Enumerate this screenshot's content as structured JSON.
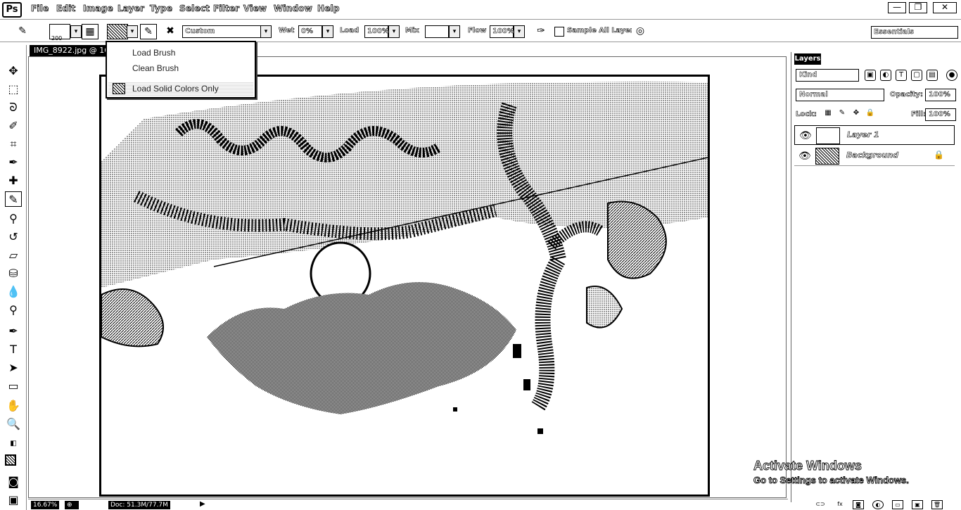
{
  "app": {
    "logo": "Ps",
    "menu": [
      "File",
      "Edit",
      "Image",
      "Layer",
      "Type",
      "Select",
      "Filter",
      "View",
      "Window",
      "Help"
    ],
    "window_controls": [
      "—",
      "❐",
      "✕"
    ]
  },
  "options_bar": {
    "brush_size": "200",
    "mode_label": "Custom",
    "wet_label": "Wet",
    "wet_value": "0%",
    "load_label": "Load",
    "load_value": "100%",
    "mix_label": "Mix",
    "mix_value": "",
    "flow_label": "Flow",
    "flow_value": "100%",
    "sample_all_layers": "Sample All Layers",
    "workspace": "Essentials"
  },
  "brush_menu": {
    "items": [
      "Load Brush",
      "Clean Brush",
      "Load Solid Colors Only"
    ],
    "checked_item": "Load Solid Colors Only"
  },
  "document": {
    "tab_title": "IMG_8922.jpg @ 16"
  },
  "layers_panel": {
    "tab": "Layers",
    "filter_kind": "Kind",
    "blend_mode": "Normal",
    "opacity_label": "Opacity:",
    "opacity_value": "100%",
    "lock_label": "Lock:",
    "fill_label": "Fill:",
    "fill_value": "100%",
    "layers": [
      {
        "name": "Layer 1"
      },
      {
        "name": "Background"
      }
    ]
  },
  "status": {
    "zoom": "16.67%",
    "doc_info": "Doc: 51.3M/77.7M"
  },
  "watermark": {
    "title": "Activate Windows",
    "subtitle": "Go to Settings to activate Windows."
  }
}
